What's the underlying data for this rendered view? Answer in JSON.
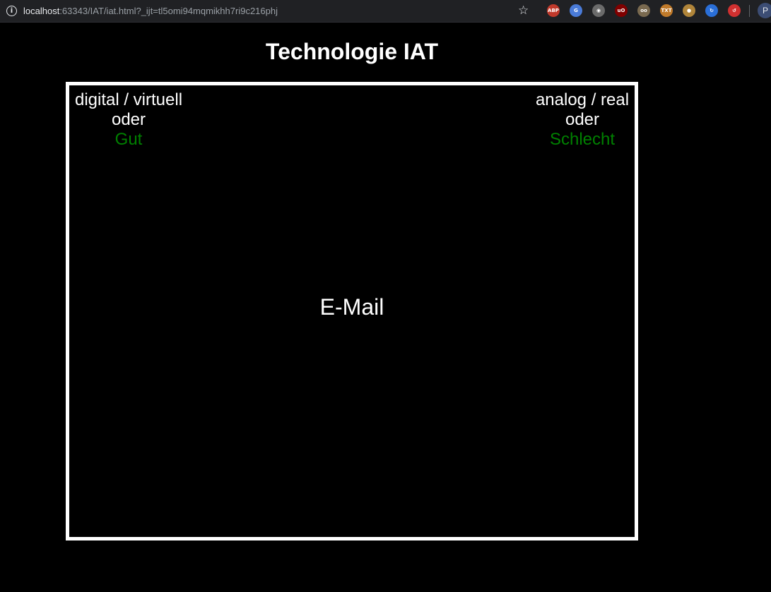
{
  "browser": {
    "url_host": "localhost",
    "url_rest": ":63343/IAT/iat.html?_ijt=tl5omi94mqmikhh7ri9c216phj",
    "profile_initial": "P",
    "extensions": [
      {
        "name": "adblock-plus-icon",
        "label": "ABP",
        "color": "#c0392b"
      },
      {
        "name": "google-translate-icon",
        "label": "G",
        "color": "#4a7bd8"
      },
      {
        "name": "camera-icon",
        "label": "◉",
        "color": "#6b6b6b"
      },
      {
        "name": "ublock-origin-icon",
        "label": "uO",
        "color": "#800000"
      },
      {
        "name": "owl-icon",
        "label": "oo",
        "color": "#7a6a50"
      },
      {
        "name": "text-extension-icon",
        "label": "TXT",
        "color": "#c07a2a"
      },
      {
        "name": "cookie-icon",
        "label": "●",
        "color": "#b0853a"
      },
      {
        "name": "sync-icon",
        "label": "↻",
        "color": "#2a6fd8"
      },
      {
        "name": "red-circle-extension-icon",
        "label": "↺",
        "color": "#d03030"
      }
    ]
  },
  "page": {
    "title": "Technologie IAT"
  },
  "iat": {
    "left_category": {
      "target": "digital / virtuell",
      "connector": "oder",
      "attribute": "Gut"
    },
    "right_category": {
      "target": "analog / real",
      "connector": "oder",
      "attribute": "Schlecht"
    },
    "stimulus": "E-Mail",
    "colors": {
      "attribute": "#008000",
      "text": "#ffffff",
      "background": "#000000"
    }
  }
}
